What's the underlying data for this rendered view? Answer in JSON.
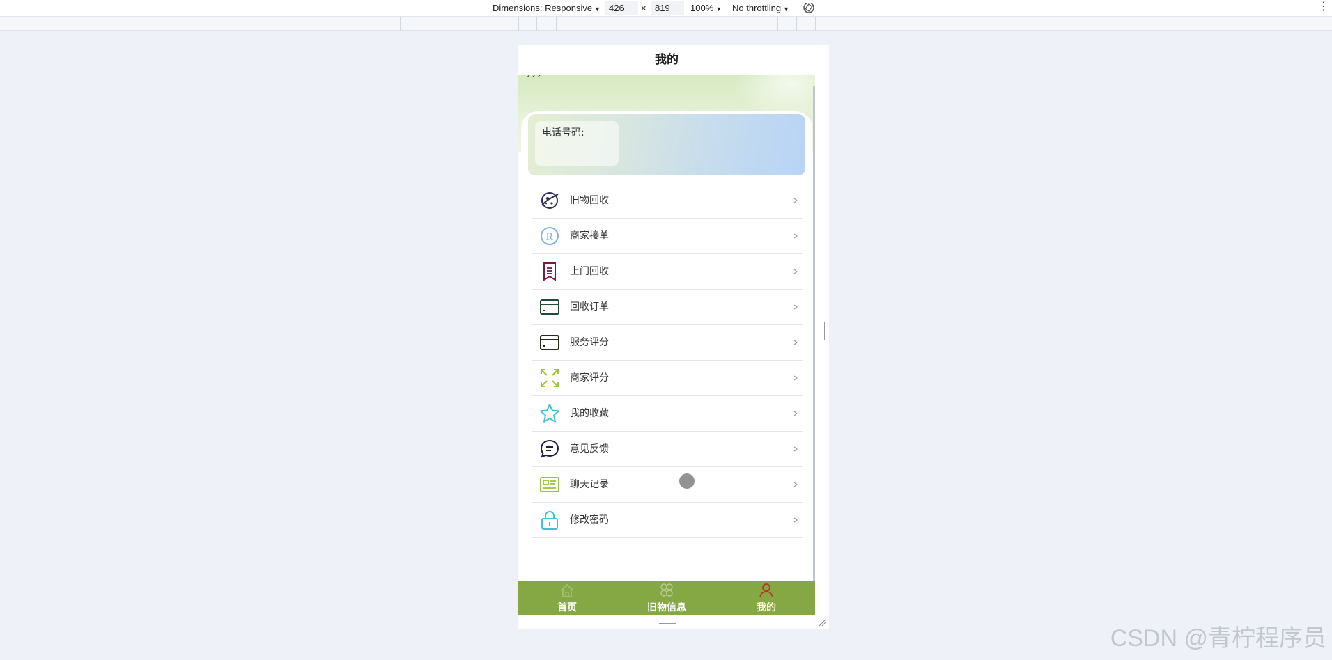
{
  "devtools": {
    "dimensions_label": "Dimensions: Responsive",
    "width": "426",
    "times": "×",
    "height": "819",
    "zoom": "100%",
    "throttling": "No throttling",
    "more_icon": "⋮"
  },
  "app": {
    "title": "我的",
    "hero_text": "222",
    "profile": {
      "phone_label": "电话号码:"
    },
    "menu": [
      {
        "label": "旧物回收",
        "icon": "recycle-planet-icon",
        "color": "#2e2a5c"
      },
      {
        "label": "商家接单",
        "icon": "registered-icon",
        "color": "#7fb2e5"
      },
      {
        "label": "上门回收",
        "icon": "bookmark-list-icon",
        "color": "#7a1846"
      },
      {
        "label": "回收订单",
        "icon": "card-icon",
        "color": "#1f4d34"
      },
      {
        "label": "服务评分",
        "icon": "card-icon",
        "color": "#2a2a18"
      },
      {
        "label": "商家评分",
        "icon": "expand-arrows-icon",
        "color": "#9ac43c"
      },
      {
        "label": "我的收藏",
        "icon": "star-icon",
        "color": "#3ec3cf"
      },
      {
        "label": "意见反馈",
        "icon": "chat-bubble-icon",
        "color": "#1c1a4a"
      },
      {
        "label": "聊天记录",
        "icon": "id-card-icon",
        "color": "#9ac43c"
      },
      {
        "label": "修改密码",
        "icon": "lock-icon",
        "color": "#3ec3cf"
      }
    ],
    "tabs": [
      {
        "label": "首页",
        "icon": "home-icon"
      },
      {
        "label": "旧物信息",
        "icon": "grid-flower-icon"
      },
      {
        "label": "我的",
        "icon": "user-icon",
        "active": true
      }
    ],
    "tab_bar_color": "#85a845"
  },
  "watermark": "CSDN @青柠程序员"
}
